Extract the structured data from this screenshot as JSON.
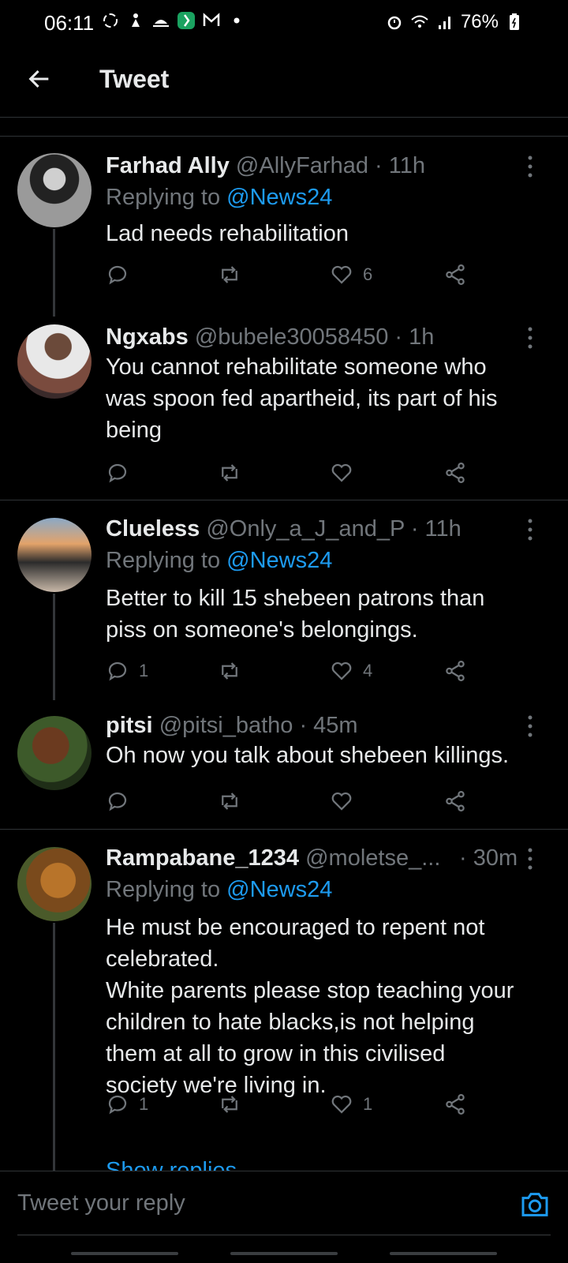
{
  "status_bar": {
    "time": "06:11",
    "battery": "76%"
  },
  "header": {
    "title": "Tweet"
  },
  "tweets": [
    {
      "name": "Farhad Ally",
      "meta": "@AllyFarhad · 11h",
      "replying_prefix": "Replying to ",
      "replying_to": "@News24",
      "text": "Lad needs rehabilitation",
      "replies": "",
      "likes": "6"
    },
    {
      "name": "Ngxabs",
      "meta": "@bubele30058450 · 1h",
      "text": "You cannot rehabilitate someone who\nwas spoon fed apartheid, its part of his\nbeing",
      "replies": "",
      "likes": ""
    },
    {
      "name": "Clueless",
      "meta": "@Only_a_J_and_P · 11h",
      "replying_prefix": "Replying to ",
      "replying_to": "@News24",
      "text": "Better to kill 15 shebeen patrons than\npiss on someone's belongings.",
      "replies": "1",
      "likes": "4"
    },
    {
      "name": "pitsi",
      "meta": "@pitsi_batho · 45m",
      "text": "Oh now you talk about shebeen killings.",
      "replies": "",
      "likes": ""
    },
    {
      "name": "Rampabane_1234",
      "meta": "@moletse_...",
      "time": "· 30m",
      "replying_prefix": "Replying to ",
      "replying_to": "@News24",
      "text": "He must be encouraged to repent not\ncelebrated.\nWhite parents please stop teaching your\nchildren to hate blacks,is not helping\nthem at all to grow in this civilised\nsociety we're living in.",
      "replies": "1",
      "likes": "1"
    }
  ],
  "show_replies": "Show replies",
  "composer": {
    "placeholder": "Tweet your reply"
  },
  "colors": {
    "background": "#000000",
    "accent": "#1d9bf0",
    "muted": "#71767b",
    "text": "#e7e9ea"
  }
}
